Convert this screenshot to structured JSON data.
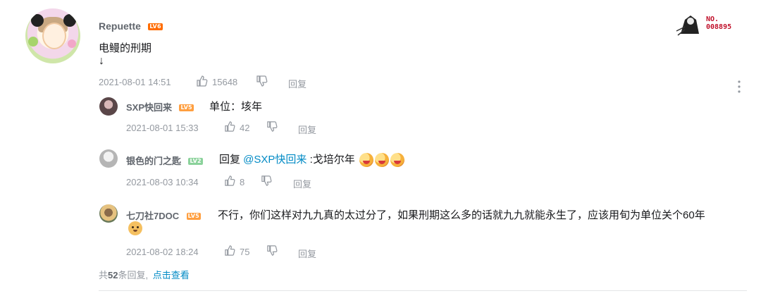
{
  "main_comment": {
    "username": "Repuette",
    "level": "LV6",
    "text_line1": "电鳗的刑期",
    "text_line2": "↓",
    "time": "2021-08-01 14:51",
    "likes": "15648",
    "reply_label": "回复",
    "medal_line1": "NO.",
    "medal_line2": "008895"
  },
  "replies": [
    {
      "username": "SXP快回来",
      "level": "LV5",
      "text": "单位：垓年",
      "time": "2021-08-01 15:33",
      "likes": "42",
      "reply_label": "回复"
    },
    {
      "username": "银色的门之匙",
      "level": "LV2",
      "reply_prefix": "回复 ",
      "mention": "@SXP快回来",
      "text": " :戈培尔年",
      "time": "2021-08-03 10:34",
      "likes": "8",
      "reply_label": "回复"
    },
    {
      "username": "七刀社7DOC",
      "level": "LV5",
      "text": "不行，你们这样对九九真的太过分了，如果刑期这么多的话就九九就能永生了，应该用旬为单位关个60年",
      "time": "2021-08-02 18:24",
      "likes": "75",
      "reply_label": "回复"
    }
  ],
  "footer": {
    "prefix": "共",
    "count": "52",
    "suffix": "条回复,",
    "view_link": "点击查看"
  },
  "colors": {
    "accent_link": "#008ac5",
    "meta": "#9499a0",
    "level6": "#ff6c00",
    "level5": "#ff9f40",
    "level2": "#8bd29b"
  }
}
